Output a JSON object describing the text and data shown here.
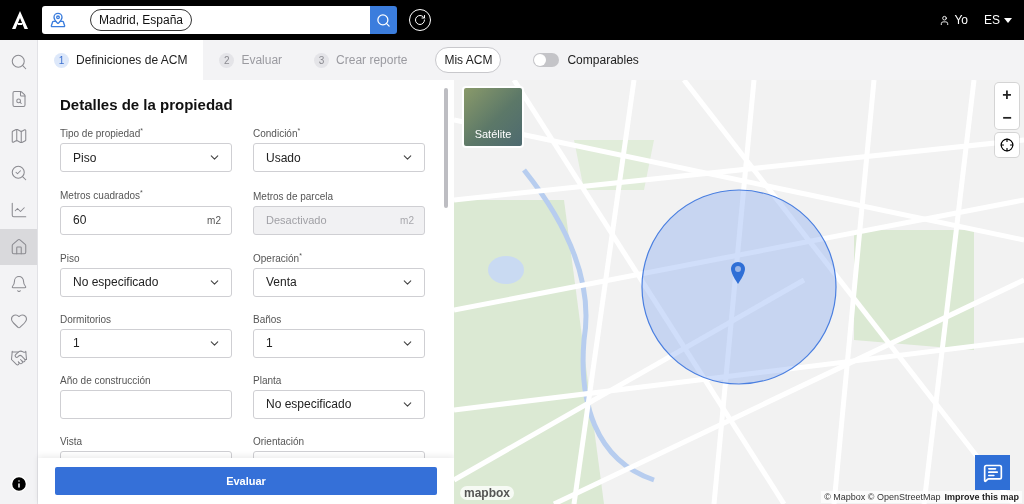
{
  "topbar": {
    "search_chip": "Madrid, España",
    "user": "Yo",
    "language": "ES"
  },
  "sidebar": {
    "items": [
      {
        "selected": false
      },
      {
        "selected": false
      },
      {
        "selected": false
      },
      {
        "selected": false
      },
      {
        "selected": false
      },
      {
        "selected": true
      },
      {
        "selected": false
      },
      {
        "selected": false
      },
      {
        "selected": false
      }
    ]
  },
  "tabs": [
    {
      "number": "1",
      "label": "Definiciones de ACM",
      "selected": true
    },
    {
      "number": "2",
      "label": "Evaluar",
      "selected": false
    },
    {
      "number": "3",
      "label": "Crear reporte",
      "selected": false
    }
  ],
  "mis_acm": "Mis ACM",
  "comparables": {
    "label": "Comparables",
    "on": false
  },
  "form": {
    "title": "Detalles de la propiedad",
    "fields": [
      {
        "kind": "select",
        "label": "Tipo de propiedad$^{*}$",
        "value": "Piso"
      },
      {
        "kind": "select",
        "label": "Condición$^{*}$",
        "value": "Usado"
      },
      {
        "kind": "input",
        "label": "Metros cuadrados$^{*}$",
        "value": "60",
        "unit": "m2",
        "disabled": false
      },
      {
        "kind": "input",
        "label": "Metros de parcela",
        "placeholder": "Desactivado",
        "unit": "m2",
        "disabled": true
      },
      {
        "kind": "select",
        "label": "Piso",
        "value": "No especificado"
      },
      {
        "kind": "select",
        "label": "Operación$^{*}$",
        "value": "Venta"
      },
      {
        "kind": "select",
        "label": "Dormitorios",
        "value": "1"
      },
      {
        "kind": "select",
        "label": "Baños",
        "value": "1"
      },
      {
        "kind": "input",
        "label": "Año de construcción",
        "disabled": false
      },
      {
        "kind": "select",
        "label": "Planta",
        "value": "No especificado"
      },
      {
        "kind": "select",
        "label": "Vista"
      },
      {
        "kind": "select",
        "label": "Orientación"
      }
    ],
    "submit": "Evaluar"
  },
  "map": {
    "satellite_label": "Satélite",
    "zoom_in": "+",
    "zoom_out": "−",
    "logo": "mapbox",
    "attribution": "© Mapbox © OpenStreetMap",
    "improve_link": "Improve this map"
  }
}
